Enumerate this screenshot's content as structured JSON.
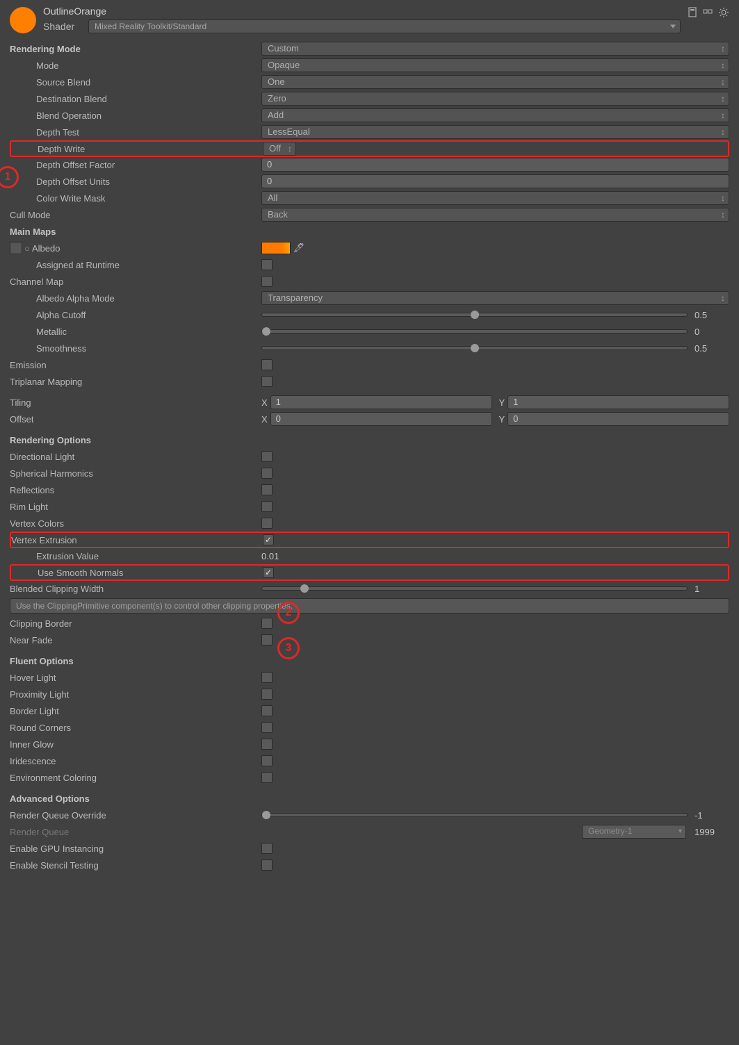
{
  "header": {
    "title": "OutlineOrange",
    "shaderLabel": "Shader",
    "shaderValue": "Mixed Reality Toolkit/Standard"
  },
  "rm": {
    "title": "Rendering Mode",
    "value": "Custom",
    "mode": {
      "label": "Mode",
      "value": "Opaque"
    },
    "sblend": {
      "label": "Source Blend",
      "value": "One"
    },
    "dblend": {
      "label": "Destination Blend",
      "value": "Zero"
    },
    "bop": {
      "label": "Blend Operation",
      "value": "Add"
    },
    "dtest": {
      "label": "Depth Test",
      "value": "LessEqual"
    },
    "dwrite": {
      "label": "Depth Write",
      "value": "Off"
    },
    "doff": {
      "label": "Depth Offset Factor",
      "value": "0"
    },
    "dou": {
      "label": "Depth Offset Units",
      "value": "0"
    },
    "cwm": {
      "label": "Color Write Mask",
      "value": "All"
    },
    "cull": {
      "label": "Cull Mode",
      "value": "Back"
    }
  },
  "mm": {
    "title": "Main Maps",
    "albedo": {
      "label": "Albedo"
    },
    "aar": {
      "label": "Assigned at Runtime"
    },
    "chmap": {
      "label": "Channel Map"
    },
    "aam": {
      "label": "Albedo Alpha Mode",
      "value": "Transparency"
    },
    "acut": {
      "label": "Alpha Cutoff",
      "value": "0.5",
      "pct": 50
    },
    "met": {
      "label": "Metallic",
      "value": "0",
      "pct": 0
    },
    "smooth": {
      "label": "Smoothness",
      "value": "0.5",
      "pct": 50
    },
    "emis": {
      "label": "Emission"
    },
    "trip": {
      "label": "Triplanar Mapping"
    },
    "tiling": {
      "label": "Tiling",
      "x": "1",
      "y": "1"
    },
    "offset": {
      "label": "Offset",
      "x": "0",
      "y": "0"
    }
  },
  "ro": {
    "title": "Rendering Options",
    "dl": "Directional Light",
    "sh": "Spherical Harmonics",
    "rf": "Reflections",
    "rl": "Rim Light",
    "vc": "Vertex Colors",
    "ve": "Vertex Extrusion",
    "ev": {
      "label": "Extrusion Value",
      "value": "0.01"
    },
    "usn": "Use Smooth Normals",
    "bcw": {
      "label": "Blended Clipping Width",
      "value": "1",
      "pct": 10
    },
    "note": "Use the ClippingPrimitive component(s) to control other clipping properties.",
    "cb": "Clipping Border",
    "nf": "Near Fade"
  },
  "fo": {
    "title": "Fluent Options",
    "hl": "Hover Light",
    "pl": "Proximity Light",
    "bl": "Border Light",
    "rc": "Round Corners",
    "ig": "Inner Glow",
    "ir": "Iridescence",
    "ec": "Environment Coloring"
  },
  "ao": {
    "title": "Advanced Options",
    "rqo": {
      "label": "Render Queue Override",
      "value": "-1",
      "pct": 0
    },
    "rq": {
      "label": "Render Queue",
      "box": "Geometry-1",
      "value": "1999"
    },
    "gpu": "Enable GPU Instancing",
    "st": "Enable Stencil Testing"
  },
  "annot": {
    "n1": "1",
    "n2": "2",
    "n3": "3"
  }
}
